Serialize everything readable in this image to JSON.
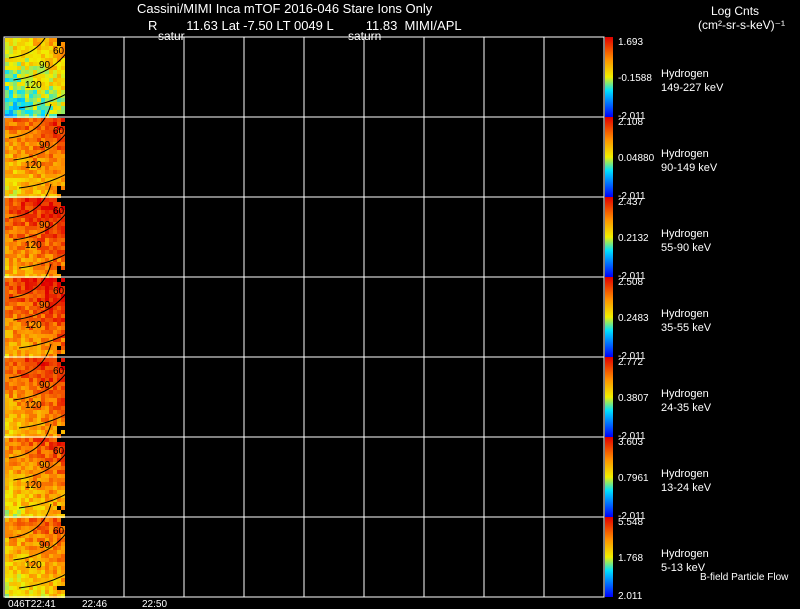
{
  "header": {
    "title": "Cassini/MIMI Inca mTOF  2016-046   Stare   Ions Only",
    "line2": "R        11.63 Lat -7.50 LT 0049 L         11.83  MIMI/APL",
    "label_left": "satur",
    "label_mid": "saturn",
    "units_line1": "Log Cnts",
    "units_line2": "(cm²-sr-s-keV)⁻¹"
  },
  "footer_note": "B-field Particle Flow",
  "colors": {
    "background": "#000000",
    "grid": "#ffffff"
  },
  "chart_data": {
    "type": "heatmap",
    "description_of_axes": "time",
    "x_ticks": [
      "046T22:41",
      "22:46",
      "22:50"
    ],
    "panels": [
      {
        "species": "Hydrogen",
        "energy": "149-227 keV",
        "cb_max": "1.693",
        "cb_mid": "-0.1588",
        "cb_min": "-2.011",
        "contours": [
          "60",
          "90",
          "120"
        ],
        "intensity": 0.55
      },
      {
        "species": "Hydrogen",
        "energy": "90-149 keV",
        "cb_max": "2.108",
        "cb_mid": "0.04880",
        "cb_min": "-2.011",
        "contours": [
          "60",
          "90",
          "120"
        ],
        "intensity": 0.78
      },
      {
        "species": "Hydrogen",
        "energy": "55-90 keV",
        "cb_max": "2.437",
        "cb_mid": "0.2132",
        "cb_min": "-2.011",
        "contours": [
          "60",
          "90",
          "120"
        ],
        "intensity": 0.86
      },
      {
        "species": "Hydrogen",
        "energy": "35-55 keV",
        "cb_max": "2.508",
        "cb_mid": "0.2483",
        "cb_min": "-2.011",
        "contours": [
          "60",
          "90",
          "120"
        ],
        "intensity": 0.86
      },
      {
        "species": "Hydrogen",
        "energy": "24-35 keV",
        "cb_max": "2.772",
        "cb_mid": "0.3807",
        "cb_min": "-2.011",
        "contours": [
          "60",
          "90",
          "120"
        ],
        "intensity": 0.82
      },
      {
        "species": "Hydrogen",
        "energy": "13-24 keV",
        "cb_max": "3.603",
        "cb_mid": "0.7961",
        "cb_min": "-2.011",
        "contours": [
          "60",
          "90",
          "120"
        ],
        "intensity": 0.76
      },
      {
        "species": "Hydrogen",
        "energy": "5-13 keV",
        "cb_max": "5.548",
        "cb_mid": "1.768",
        "cb_min": "2.011",
        "contours": [
          "60",
          "90",
          "120"
        ],
        "intensity": 0.72
      }
    ]
  }
}
